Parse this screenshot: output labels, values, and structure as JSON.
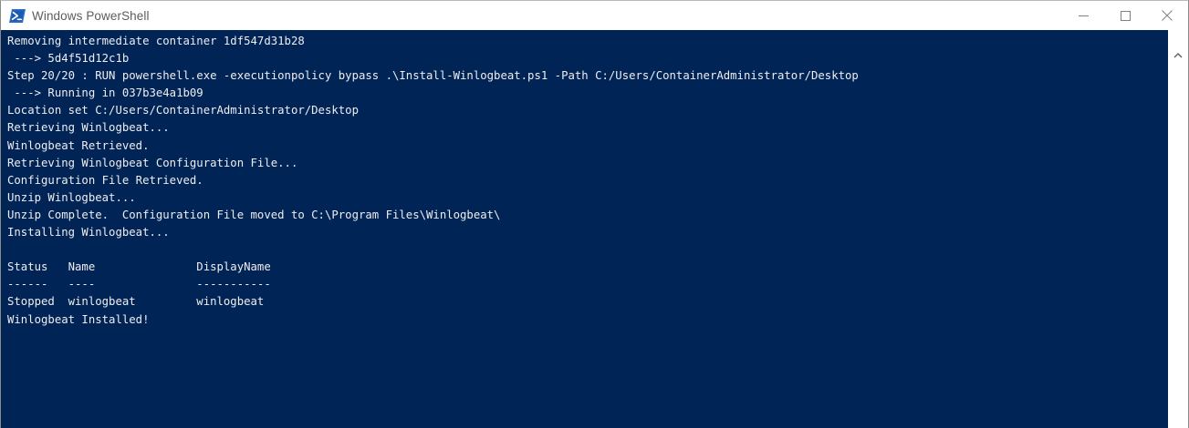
{
  "window": {
    "title": "Windows PowerShell",
    "icon": "powershell-icon",
    "controls": [
      "minimize-icon",
      "maximize-icon",
      "close-icon"
    ]
  },
  "colors": {
    "console_background": "#012456",
    "console_text": "#eeedf0",
    "titlebar_background": "#ffffff",
    "title_text": "#5c5c5c"
  },
  "console": {
    "lines": [
      "Removing intermediate container 1df547d31b28",
      " ---> 5d4f51d12c1b",
      "Step 20/20 : RUN powershell.exe -executionpolicy bypass .\\Install-Winlogbeat.ps1 -Path C:/Users/ContainerAdministrator/Desktop",
      " ---> Running in 037b3e4a1b09",
      "Location set C:/Users/ContainerAdministrator/Desktop",
      "Retrieving Winlogbeat...",
      "Winlogbeat Retrieved.",
      "Retrieving Winlogbeat Configuration File...",
      "Configuration File Retrieved.",
      "Unzip Winlogbeat...",
      "Unzip Complete.  Configuration File moved to C:\\Program Files\\Winlogbeat\\",
      "Installing Winlogbeat...",
      "",
      "Status   Name               DisplayName",
      "------   ----               -----------",
      "Stopped  winlogbeat         winlogbeat",
      "Winlogbeat Installed!"
    ]
  },
  "scrollbar": {
    "up_icon": "chevron-up-icon"
  }
}
